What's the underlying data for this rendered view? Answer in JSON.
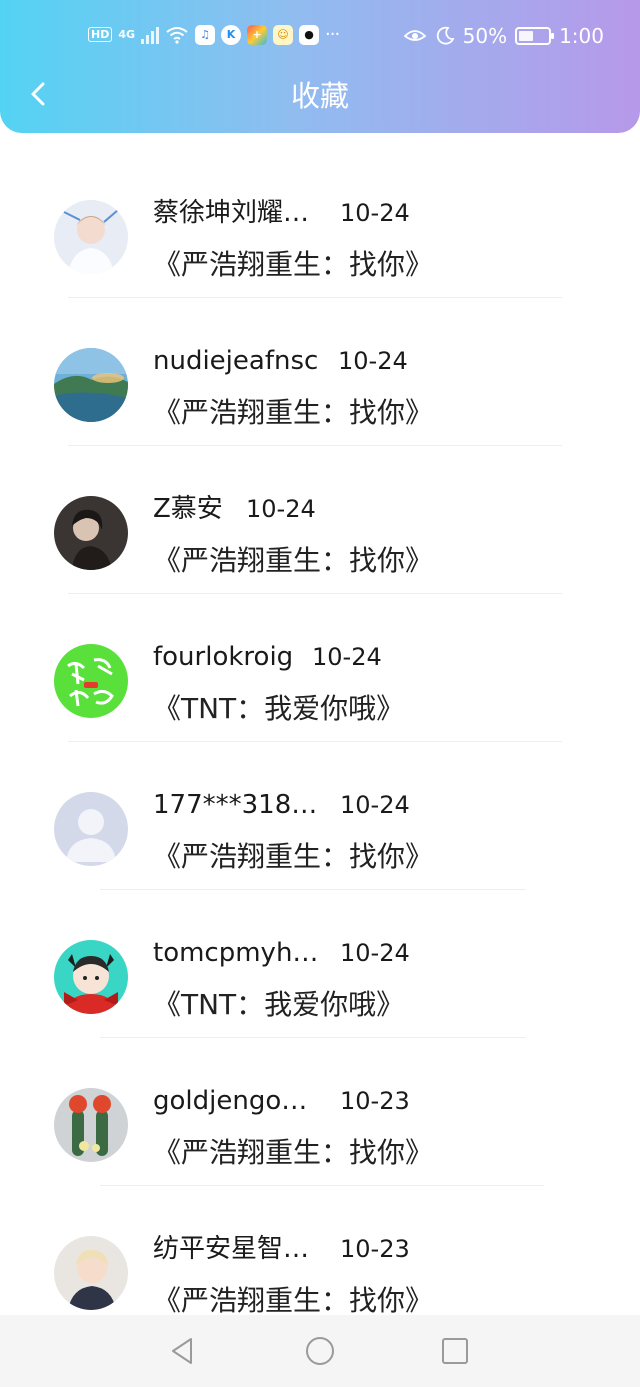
{
  "status_bar": {
    "hd": "HD",
    "network": "4G",
    "battery_percent": "50%",
    "time": "1:00",
    "battery_level": 0.5,
    "dots": "···"
  },
  "header": {
    "title": "收藏",
    "back_icon": "chevron-left-icon"
  },
  "favorites": [
    {
      "name": "蔡徐坤刘耀…",
      "date": "10-24",
      "work": "《严浩翔重生：找你》",
      "avatar": "avatar-boy"
    },
    {
      "name": "nudiejeafnsc",
      "date": "10-24",
      "work": "《严浩翔重生：找你》",
      "avatar": "avatar-landscape"
    },
    {
      "name": "Z慕安",
      "date": "10-24",
      "work": "《严浩翔重生：找你》",
      "avatar": "avatar-girl-dark"
    },
    {
      "name": "fourlokroig",
      "date": "10-24",
      "work": "《TNT：我爱你哦》",
      "avatar": "avatar-green-text"
    },
    {
      "name": "177***318…",
      "date": "10-24",
      "work": "《严浩翔重生：找你》",
      "avatar": "avatar-default"
    },
    {
      "name": "tomcpmyh…",
      "date": "10-24",
      "work": "《TNT：我爱你哦》",
      "avatar": "avatar-cartoon"
    },
    {
      "name": "goldjengo…",
      "date": "10-23",
      "work": "《严浩翔重生：找你》",
      "avatar": "avatar-cactus"
    },
    {
      "name": "纺平安星智…",
      "date": "10-23",
      "work": "《严浩翔重生：找你》",
      "avatar": "avatar-child"
    }
  ],
  "navbar": {
    "back": "triangle-back-icon",
    "home": "circle-home-icon",
    "recents": "square-recents-icon"
  }
}
